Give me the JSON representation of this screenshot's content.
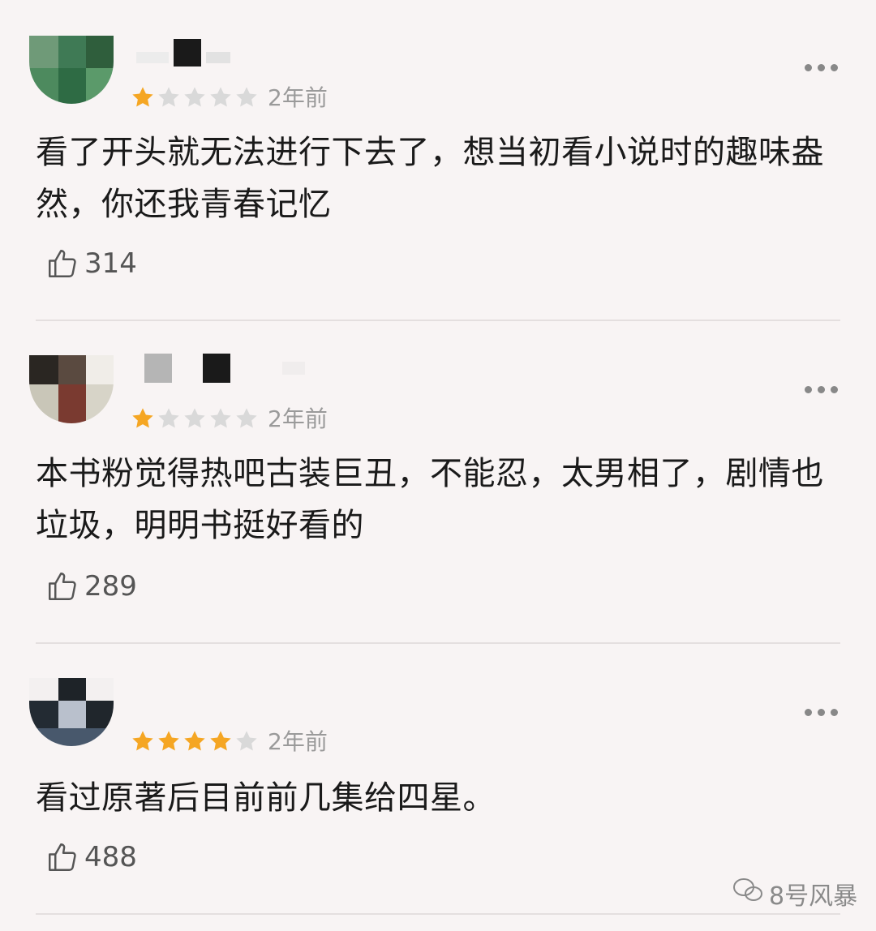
{
  "reviews": [
    {
      "rating": 1,
      "max_rating": 5,
      "time": "2年前",
      "content": "看了开头就无法进行下去了，想当初看小说时的趣味盎然，你还我青春记忆",
      "likes": "314"
    },
    {
      "rating": 1,
      "max_rating": 5,
      "time": "2年前",
      "content": "本书粉觉得热吧古装巨丑，不能忍，太男相了，剧情也垃圾，明明书挺好看的",
      "likes": "289"
    },
    {
      "rating": 4,
      "max_rating": 5,
      "time": "2年前",
      "content": "看过原著后目前前几集给四星。",
      "likes": "488"
    }
  ],
  "watermark": "8号风暴",
  "colors": {
    "star_filled": "#f5a623",
    "star_empty": "#d9d9d9",
    "background": "#f8f4f4"
  },
  "icons": [
    "more-icon",
    "thumbs-up-icon",
    "star-icon",
    "wechat-icon"
  ]
}
